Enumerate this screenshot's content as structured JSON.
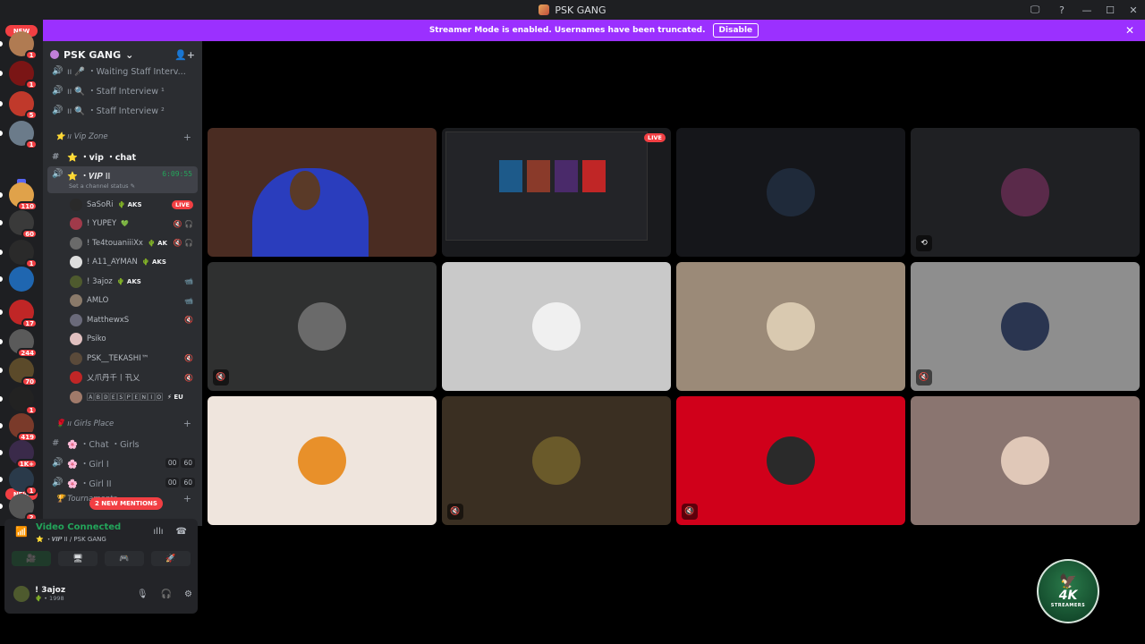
{
  "window": {
    "title": "PSK GANG",
    "controls": [
      "🖵",
      "?",
      "—",
      "☐",
      "✕"
    ]
  },
  "banner": {
    "text": "Streamer Mode is enabled. Usernames have been truncated.",
    "button": "Disable",
    "close": "✕"
  },
  "rail": {
    "new_top": "NEW",
    "new_bottom": "NEW",
    "servers": [
      {
        "badge": "1",
        "color": "#b07b52"
      },
      {
        "badge": "1",
        "color": "#7a1515"
      },
      {
        "badge": "5",
        "color": "#c0392b"
      },
      {
        "badge": "1",
        "color": "#6b7b8a"
      },
      {
        "badge": "110",
        "color": "#e0a24a"
      },
      {
        "badge": "60",
        "color": "#3a3a3a"
      },
      {
        "badge": "1",
        "color": "#2a2a2a"
      },
      {
        "badge": "",
        "color": "#1f66b0"
      },
      {
        "badge": "17",
        "color": "#c02626"
      },
      {
        "badge": "244",
        "color": "#5a5a5a"
      },
      {
        "badge": "70",
        "color": "#5b4a2a"
      },
      {
        "badge": "1",
        "color": "#222222"
      },
      {
        "badge": "419",
        "color": "#7a3a2a"
      },
      {
        "badge": "1K+",
        "color": "#3a2a4a"
      },
      {
        "badge": "1",
        "color": "#2a3a4a"
      },
      {
        "badge": "2",
        "color": "#555555"
      }
    ]
  },
  "sidebar": {
    "guild_name": "PSK GANG",
    "channels_top": [
      {
        "name": "ıı 🎤 ・Waiting Staff Interv..."
      },
      {
        "name": "ıı 🔍 ・Staff Interview ¹"
      },
      {
        "name": "ıı 🔍 ・Staff Interview ²"
      }
    ],
    "vip_category": "⭐ ıı Vip Zone",
    "vip_chat": "⭐ ・vip ・chat",
    "active_channel": "⭐ ・𝑽𝑰𝑷 II",
    "active_timer": "6:09:55",
    "channel_status": "Set a channel status ✎",
    "voice_users": [
      {
        "name": "SaSoRi",
        "tag": "🌵 AKS",
        "right": "LIVE",
        "color": "#2a2a2a"
      },
      {
        "name": "! YUPEY",
        "tag": "💚",
        "right": "🔇 🎧",
        "color": "#a03a4a"
      },
      {
        "name": "! Te4touaniiiXx",
        "tag": "🌵 AK",
        "right": "🔇 🎧",
        "color": "#6a6a6a"
      },
      {
        "name": "! A11_AYMAN",
        "tag": "🌵 AKS",
        "right": "",
        "color": "#dddddd"
      },
      {
        "name": "! 3ajoz",
        "tag": "🌵 AKS",
        "right": "📹",
        "color": "#4e5a2e"
      },
      {
        "name": "AMLO",
        "tag": "",
        "right": "📹",
        "color": "#8a7a6a"
      },
      {
        "name": "MatthewxS",
        "tag": "",
        "right": "🔇",
        "color": "#6a6a7a"
      },
      {
        "name": "Psiko",
        "tag": "",
        "right": "",
        "color": "#e0c0c0"
      },
      {
        "name": "PSK__TEKASHI™",
        "tag": "",
        "right": "🔇",
        "color": "#5a4a3a"
      },
      {
        "name": "乂爪丹千丨卂乂",
        "tag": "",
        "right": "🔇",
        "color": "#c02626"
      },
      {
        "name": "🄰🄱🄳🄴🅂🄿🄴🄽🄸🄾",
        "tag": "⚡ EU",
        "right": "",
        "color": "#a07a6a"
      }
    ],
    "girls_category": "🌹 ıı Girls Place",
    "girls_channels": [
      {
        "name": "🌸 ・Chat ・Girls",
        "type": "text",
        "a": "",
        "b": ""
      },
      {
        "name": "🌸 ・Girl I",
        "type": "voice",
        "a": "00",
        "b": "60"
      },
      {
        "name": "🌸 ・Girl II",
        "type": "voice",
        "a": "00",
        "b": "60"
      }
    ],
    "tournaments": "🏆 Tournaments",
    "mentions": "2 NEW MENTIONS"
  },
  "voice_panel": {
    "title": "Video Connected",
    "subtitle": "⭐ ・𝑽𝑰𝑷 II / PSK GANG",
    "buttons": [
      "🎥",
      "🖥",
      "🎮",
      "🚀"
    ]
  },
  "user": {
    "name": "! 3ajoz",
    "sub": "🌵 • 1998"
  },
  "tiles": [
    {
      "kind": "camera",
      "bg": "#4a2c22",
      "icon": "",
      "live": false
    },
    {
      "kind": "screen",
      "bg": "#1a1b1e",
      "icon": "",
      "live": true
    },
    {
      "kind": "avatar",
      "bg": "#15161a",
      "av": "#1f2a3a",
      "icon": "",
      "live": false
    },
    {
      "kind": "avatar",
      "bg": "#1f2023",
      "av": "#5a2a4a",
      "icon": "⟲",
      "live": false
    },
    {
      "kind": "avatar",
      "bg": "#2f3030",
      "av": "#6a6a6a",
      "icon": "🔇",
      "live": false
    },
    {
      "kind": "avatar",
      "bg": "#c9c9c9",
      "av": "#f0f0f0",
      "icon": "",
      "live": false
    },
    {
      "kind": "avatar",
      "bg": "#9b8a78",
      "av": "#d9c9b0",
      "icon": "",
      "live": false
    },
    {
      "kind": "avatar",
      "bg": "#8e8e8e",
      "av": "#2a3550",
      "icon": "🔇",
      "live": false
    },
    {
      "kind": "avatar",
      "bg": "#efe5dd",
      "av": "#e8902a",
      "icon": "",
      "live": false
    },
    {
      "kind": "avatar",
      "bg": "#3a2f22",
      "av": "#6a5a2a",
      "icon": "🔇",
      "live": false
    },
    {
      "kind": "avatar",
      "bg": "#d0001a",
      "av": "#2a2a2a",
      "icon": "🔇",
      "live": false
    },
    {
      "kind": "avatar",
      "bg": "#8a7570",
      "av": "#e0c8b8",
      "icon": "",
      "live": false
    }
  ],
  "live_label": "LIVE",
  "logo": {
    "top": "🦅",
    "big": "4K",
    "small": "STREAMERS"
  }
}
